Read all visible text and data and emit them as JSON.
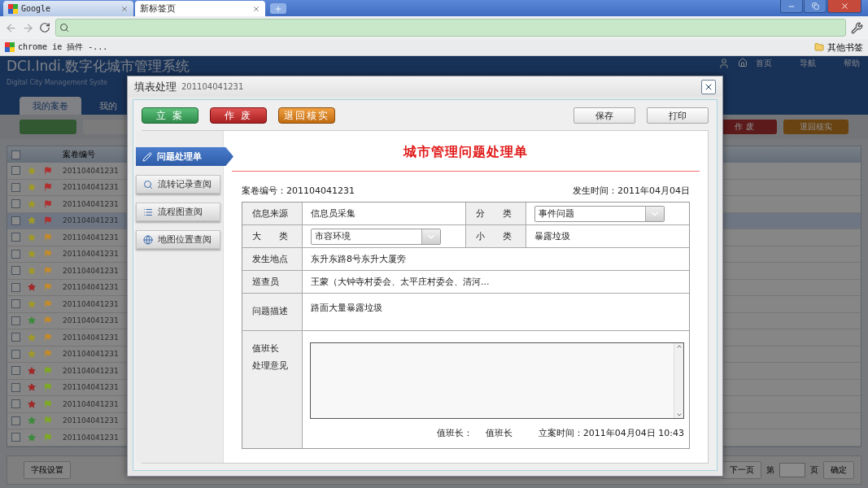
{
  "browser": {
    "tabs": [
      {
        "title": "Google",
        "selected": false
      },
      {
        "title": "新标签页",
        "selected": true
      }
    ],
    "bookmarks": [
      {
        "label": "chrome ie 插件 -..."
      }
    ],
    "other_bookmarks": "其他书签"
  },
  "app": {
    "title": "DCI.Indi.数字化城市管理系统",
    "subtitle": "Digital City Management Syste",
    "header_links": [
      "首页",
      "导航",
      "帮助"
    ],
    "nav_tabs": [
      {
        "label": "我的案卷",
        "selected": true
      },
      {
        "label": "我的",
        "selected": false
      }
    ],
    "toolbar_buttons": [
      {
        "label": "作 废",
        "kind": "void"
      },
      {
        "label": "退回核实",
        "kind": "return"
      }
    ],
    "grid": {
      "id_column": "案卷编号",
      "all_checked": false,
      "rows": [
        {
          "id": "201104041231",
          "checked": false,
          "star": {
            "color": "#a09a2a"
          },
          "flag": {
            "color": "#b03030"
          },
          "selected": false
        },
        {
          "id": "201104041231",
          "checked": false,
          "star": {
            "color": "#a09a2a"
          },
          "flag": {
            "color": "#b03030"
          },
          "selected": false
        },
        {
          "id": "201104041231",
          "checked": false,
          "star": {
            "color": "#a09a2a"
          },
          "flag": {
            "color": "#b03030"
          },
          "selected": false
        },
        {
          "id": "201104041231",
          "checked": false,
          "star": {
            "color": "#a09a2a"
          },
          "flag": {
            "color": "#b03030"
          },
          "selected": true
        },
        {
          "id": "201104041231",
          "checked": false,
          "star": {
            "color": "#a09a2a"
          },
          "flag": {
            "color": "#c08a30"
          },
          "selected": false
        },
        {
          "id": "201104041231",
          "checked": false,
          "star": {
            "color": "#a09a2a"
          },
          "flag": {
            "color": "#c08a30"
          },
          "selected": false
        },
        {
          "id": "201104041231",
          "checked": false,
          "star": {
            "color": "#a09a2a"
          },
          "flag": {
            "color": "#c08a30"
          },
          "selected": false
        },
        {
          "id": "201104041231",
          "checked": false,
          "star": {
            "color": "#a02828"
          },
          "flag": {
            "color": "#c08a30"
          },
          "selected": false
        },
        {
          "id": "201104041231",
          "checked": false,
          "star": {
            "color": "#a09a2a"
          },
          "flag": {
            "color": "#c08a30"
          },
          "selected": false
        },
        {
          "id": "201104041231",
          "checked": false,
          "star": {
            "color": "#3c8a3c"
          },
          "flag": {
            "color": "#c08a30"
          },
          "selected": false
        },
        {
          "id": "201104041231",
          "checked": false,
          "star": {
            "color": "#a09a2a"
          },
          "flag": {
            "color": "#c08a30"
          },
          "selected": false
        },
        {
          "id": "201104041231",
          "checked": false,
          "star": {
            "color": "#a09a2a"
          },
          "flag": {
            "color": "#c08a30"
          },
          "selected": false
        },
        {
          "id": "201104041231",
          "checked": false,
          "star": {
            "color": "#a02828"
          },
          "flag": {
            "color": "#80a828"
          },
          "selected": false
        },
        {
          "id": "201104041231",
          "checked": false,
          "star": {
            "color": "#a02828"
          },
          "flag": {
            "color": "#80a828"
          },
          "selected": false
        },
        {
          "id": "201104041231",
          "checked": false,
          "star": {
            "color": "#a02828"
          },
          "flag": {
            "color": "#80a828"
          },
          "selected": false
        },
        {
          "id": "201104041231",
          "checked": false,
          "star": {
            "color": "#3c8a3c"
          },
          "flag": {
            "color": "#80a828"
          },
          "selected": false
        },
        {
          "id": "201104041231",
          "checked": false,
          "star": {
            "color": "#3c8a3c"
          },
          "flag": {
            "color": "#80a828"
          },
          "selected": false
        }
      ]
    },
    "footer": {
      "settings_button": "字段设置",
      "next_page": "下一页",
      "page_prefix": "第",
      "page_suffix": "页",
      "go_button": "确定"
    }
  },
  "dialog": {
    "title": "填表处理",
    "case_id": "201104041231",
    "actions": [
      {
        "label": "立 案",
        "kind": "approve"
      },
      {
        "label": "作 废",
        "kind": "void"
      },
      {
        "label": "退回核实",
        "kind": "return"
      }
    ],
    "right_buttons": [
      "保存",
      "打印"
    ],
    "side_nav": [
      {
        "label": "问题处理单",
        "selected": true
      },
      {
        "label": "流转记录查阅",
        "selected": false
      },
      {
        "label": "流程图查阅",
        "selected": false
      },
      {
        "label": "地图位置查阅",
        "selected": false
      }
    ],
    "form": {
      "title": "城市管理问题处理单",
      "case_number": "案卷编号：201104041231",
      "occurred_time": "发生时间：2011年04月04日",
      "rows": [
        {
          "cells": [
            {
              "label": "信息来源",
              "kind": "text",
              "value": "信息员采集"
            },
            {
              "label": "分　　类",
              "kind": "select",
              "value": "事件问题"
            }
          ]
        },
        {
          "cells": [
            {
              "label": "大　　类",
              "kind": "select",
              "value": "市容环境"
            },
            {
              "label": "小　　类",
              "kind": "text",
              "value": "暴露垃圾"
            }
          ]
        },
        {
          "cells": [
            {
              "label": "发生地点",
              "kind": "text",
              "value": "东升东路8号东升大厦旁"
            }
          ]
        },
        {
          "cells": [
            {
              "label": "巡查员",
              "kind": "text",
              "value": "王蒙（大钟寺村委会、太平庄村委会、清河..."
            }
          ]
        },
        {
          "cells": [
            {
              "label": "问题描述",
              "kind": "tall",
              "value": "路面大量暴露垃圾"
            }
          ]
        }
      ],
      "opinion": {
        "label_lines": [
          "值班长",
          "处理意见"
        ],
        "signer_label": "值班长：",
        "signer": "值班长",
        "filed_time": "立案时间：2011年04月04日 10:43"
      }
    }
  }
}
